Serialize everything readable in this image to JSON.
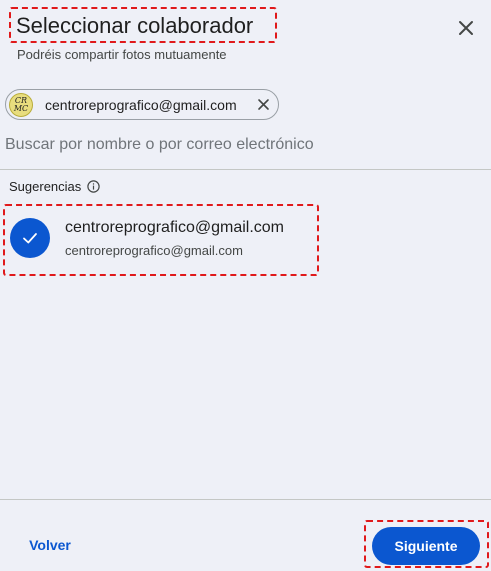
{
  "dialog": {
    "title": "Seleccionar colaborador",
    "subtitle": "Podréis compartir fotos mutuamente",
    "close_icon": "close-icon"
  },
  "chip": {
    "avatar_text": "CR\nMC",
    "label": "centroreprografico@gmail.com",
    "remove_icon": "close-icon"
  },
  "search": {
    "placeholder": "Buscar por nombre o por correo electrónico",
    "value": ""
  },
  "suggestions": {
    "header": "Sugerencias",
    "info_icon": "info-icon",
    "items": [
      {
        "name": "centroreprografico@gmail.com",
        "email": "centroreprografico@gmail.com",
        "selected": true
      }
    ]
  },
  "footer": {
    "back_label": "Volver",
    "next_label": "Siguiente"
  },
  "colors": {
    "background": "#eef0f7",
    "accent": "#0b57d0",
    "highlight_dash": "#e0191b"
  }
}
